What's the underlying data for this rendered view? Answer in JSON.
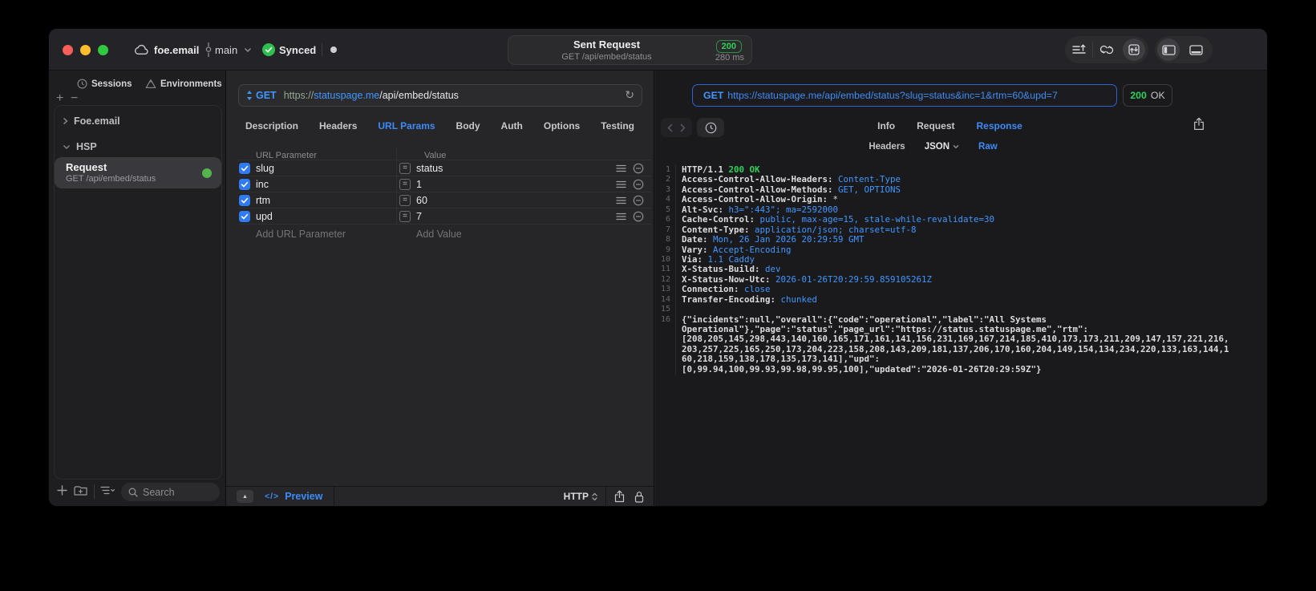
{
  "colors": {
    "accent_blue": "#3d8bf7",
    "status_green": "#30d158",
    "param_checkbox_blue": "#2f7bf5"
  },
  "titlebar": {
    "project": "foe.email",
    "branch": "main",
    "sync_status": "Synced",
    "request_title": "Sent Request",
    "request_subtitle": "GET /api/embed/status",
    "status_code": "200",
    "duration": "280 ms"
  },
  "sidebar": {
    "tabs": [
      {
        "label": "Sessions"
      },
      {
        "label": "Environments"
      }
    ],
    "tree": [
      {
        "label": "Foe.email"
      },
      {
        "label": "HSP"
      }
    ],
    "selected_request": {
      "name": "Request",
      "method_path": "GET /api/embed/status"
    },
    "search_placeholder": "Search"
  },
  "request_pane": {
    "method": "GET",
    "url_scheme": "https://",
    "url_host": "statuspage.me",
    "url_path": "/api/embed/status",
    "tabs": [
      {
        "label": "Description",
        "cls": ""
      },
      {
        "label": "Headers",
        "cls": ""
      },
      {
        "label": "URL Params",
        "cls": "active"
      },
      {
        "label": "Body",
        "cls": ""
      },
      {
        "label": "Auth",
        "cls": ""
      },
      {
        "label": "Options",
        "cls": ""
      },
      {
        "label": "Testing",
        "cls": ""
      }
    ],
    "params": {
      "col_name": "URL Parameter",
      "col_value": "Value",
      "rows": [
        {
          "name": "slug",
          "value": "status"
        },
        {
          "name": "inc",
          "value": "1"
        },
        {
          "name": "rtm",
          "value": "60"
        },
        {
          "name": "upd",
          "value": "7"
        }
      ],
      "add_name": "Add URL Parameter",
      "add_value": "Add Value"
    },
    "footer": {
      "preview_label": "Preview",
      "code_glyph": "</>",
      "protocol": "HTTP"
    }
  },
  "response_pane": {
    "method": "GET",
    "url": "https://statuspage.me/api/embed/status?slug=status&inc=1&rtm=60&upd=7",
    "status": {
      "code": "200",
      "text": "OK"
    },
    "tabs": [
      {
        "label": "Info",
        "cls": ""
      },
      {
        "label": "Request",
        "cls": ""
      },
      {
        "label": "Response",
        "cls": "active"
      }
    ],
    "subtabs": {
      "headers": "Headers",
      "format": "JSON",
      "raw": "Raw"
    },
    "response_lines": [
      {
        "num": "1",
        "name": "HTTP/1.1 ",
        "value": "200 OK",
        "cls": "status"
      },
      {
        "num": "2",
        "name": "Access-Control-Allow-Headers: ",
        "value": "Content-Type",
        "cls": "val"
      },
      {
        "num": "3",
        "name": "Access-Control-Allow-Methods: ",
        "value": "GET, OPTIONS",
        "cls": "val"
      },
      {
        "num": "4",
        "name": "Access-Control-Allow-Origin: ",
        "value": "*",
        "cls": "plain"
      },
      {
        "num": "5",
        "name": "Alt-Svc: ",
        "value": "h3=\":443\"; ma=2592000",
        "cls": "val"
      },
      {
        "num": "6",
        "name": "Cache-Control: ",
        "value": "public, max-age=15, stale-while-revalidate=30",
        "cls": "val"
      },
      {
        "num": "7",
        "name": "Content-Type: ",
        "value": "application/json; charset=utf-8",
        "cls": "val"
      },
      {
        "num": "8",
        "name": "Date: ",
        "value": "Mon, 26 Jan 2026 20:29:59 GMT",
        "cls": "val"
      },
      {
        "num": "9",
        "name": "Vary: ",
        "value": "Accept-Encoding",
        "cls": "val"
      },
      {
        "num": "10",
        "name": "Via: ",
        "value": "1.1 Caddy",
        "cls": "val"
      },
      {
        "num": "11",
        "name": "X-Status-Build: ",
        "value": "dev",
        "cls": "val"
      },
      {
        "num": "12",
        "name": "X-Status-Now-Utc: ",
        "value": "2026-01-26T20:29:59.859105261Z",
        "cls": "val"
      },
      {
        "num": "13",
        "name": "Connection: ",
        "value": "close",
        "cls": "val"
      },
      {
        "num": "14",
        "name": "Transfer-Encoding: ",
        "value": "chunked",
        "cls": "val"
      },
      {
        "num": "15",
        "name": "",
        "value": "",
        "cls": "val"
      }
    ],
    "body_lines": [
      {
        "num": "16",
        "text": "{\"incidents\":null,\"overall\":{\"code\":\"operational\",\"label\":\"All Systems"
      },
      {
        "num": "",
        "text": "Operational\"},\"page\":\"status\",\"page_url\":\"https://status.statuspage.me\",\"rtm\":"
      },
      {
        "num": "",
        "text": "[208,205,145,298,443,140,160,165,171,161,141,156,231,169,167,214,185,410,173,173,211,209,147,157,221,216,"
      },
      {
        "num": "",
        "text": "203,257,225,165,250,173,204,223,158,208,143,209,181,137,206,170,160,204,149,154,134,234,220,133,163,144,1"
      },
      {
        "num": "",
        "text": "60,218,159,138,178,135,173,141],\"upd\":"
      },
      {
        "num": "",
        "text": "[0,99.94,100,99.93,99.98,99.95,100],\"updated\":\"2026-01-26T20:29:59Z\"}"
      }
    ]
  }
}
